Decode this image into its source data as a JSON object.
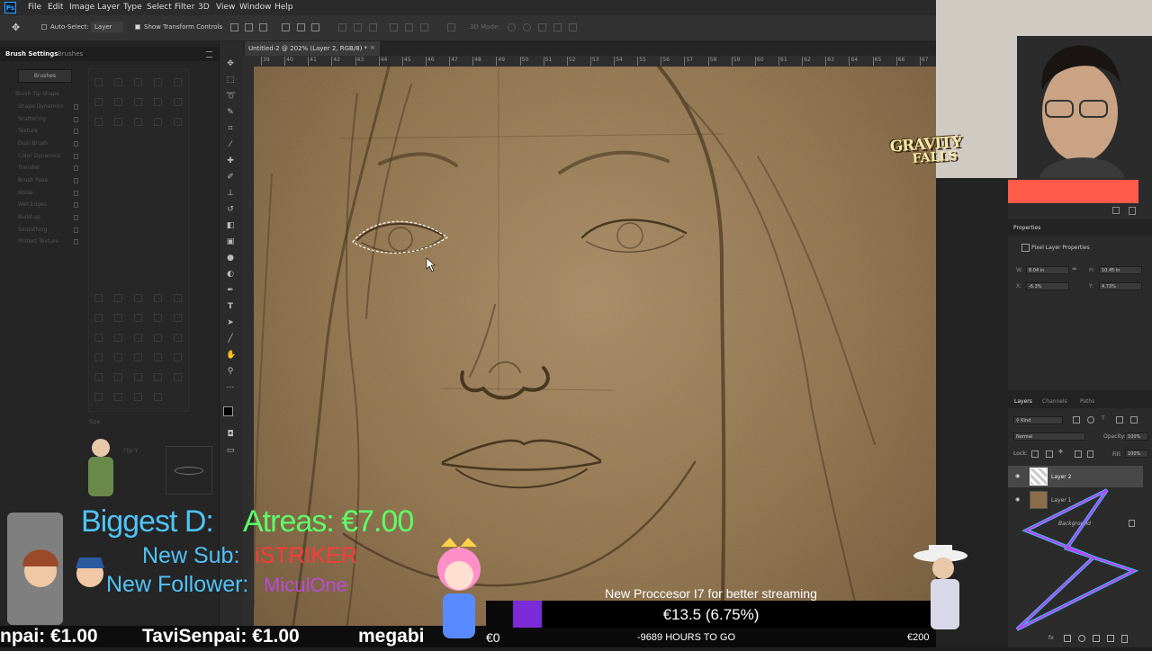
{
  "menu": {
    "logo": "Ps",
    "items": [
      "File",
      "Edit",
      "Image",
      "Layer",
      "Type",
      "Select",
      "Filter",
      "3D",
      "View",
      "Window",
      "Help"
    ]
  },
  "options": {
    "auto_select": "Auto-Select:",
    "layer_select": "Layer",
    "show_transform": "Show Transform Controls",
    "mode_3d": "3D Mode:"
  },
  "document": {
    "tab_title": "Untitled-2 @ 202% (Layer 2, RGB/8) *",
    "close": "×",
    "ruler_ticks": [
      "39",
      "40",
      "41",
      "42",
      "43",
      "44",
      "45",
      "46",
      "47",
      "48",
      "49",
      "50",
      "51",
      "52",
      "53",
      "54",
      "55",
      "56",
      "57",
      "58",
      "59",
      "60",
      "61",
      "62",
      "63",
      "64",
      "65",
      "66",
      "67"
    ]
  },
  "left_panel": {
    "tabs": [
      "Brush Settings",
      "Brushes"
    ],
    "brushes_button": "Brushes",
    "options": [
      "Brush Tip Shape",
      "Shape Dynamics",
      "Scattering",
      "Texture",
      "Dual Brush",
      "Color Dynamics",
      "Transfer",
      "Brush Pose",
      "Noise",
      "Wet Edges",
      "Build-up",
      "Smoothing",
      "Protect Texture"
    ],
    "size_label": "Size",
    "flip_label": "Flip Y"
  },
  "properties": {
    "title": "Properties",
    "subtitle": "Pixel Layer Properties",
    "w_label": "W:",
    "w_value": "8.04 in",
    "h_label": "H:",
    "h_value": "10.45 in",
    "x_label": "X:",
    "x_value": "-6.3%",
    "y_label": "Y:",
    "y_value": "4.73%"
  },
  "layers": {
    "tabs": [
      "Layers",
      "Channels",
      "Paths"
    ],
    "kind": "Kind",
    "blend": "Normal",
    "opacity_label": "Opacity:",
    "opacity_value": "100%",
    "lock_label": "Lock:",
    "fill_label": "Fill:",
    "fill_value": "100%",
    "items": [
      "Layer 2",
      "Layer 1",
      "Background"
    ]
  },
  "stream": {
    "biggest_label": "Biggest D:",
    "biggest_value": "Atreas: €7.00",
    "sub_label": "New Sub:",
    "sub_value": "iSTRIKER",
    "follower_label": "New Follower:",
    "follower_value": "MiculOne",
    "ticker": [
      "npai: €1.00",
      "TaviSenpai: €1.00",
      "megabi"
    ],
    "goal_title": "New Proccesor I7 for better streaming",
    "goal_amount": "€13.5 (6.75%)",
    "goal_min": "€0",
    "goal_hours": "-9689 HOURS TO GO",
    "goal_max": "€200",
    "logo_line1": "GRAVITY",
    "logo_line2": "FALLS"
  },
  "colors": {
    "cyan": "#4fc3f7",
    "green": "#5cff6a",
    "red": "#ff3a3a",
    "purple": "#b84bd8",
    "goal_fill": "#7a2ad6",
    "ps_blue": "#31a8ff"
  },
  "icons": [
    "move-icon",
    "marquee-icon",
    "lasso-icon",
    "quick-select-icon",
    "crop-icon",
    "eyedropper-icon",
    "healing-icon",
    "brush-icon",
    "stamp-icon",
    "history-brush-icon",
    "eraser-icon",
    "gradient-icon",
    "blur-icon",
    "dodge-icon",
    "pen-icon",
    "type-icon",
    "path-select-icon",
    "shape-icon",
    "hand-icon",
    "zoom-icon",
    "more-icon"
  ]
}
